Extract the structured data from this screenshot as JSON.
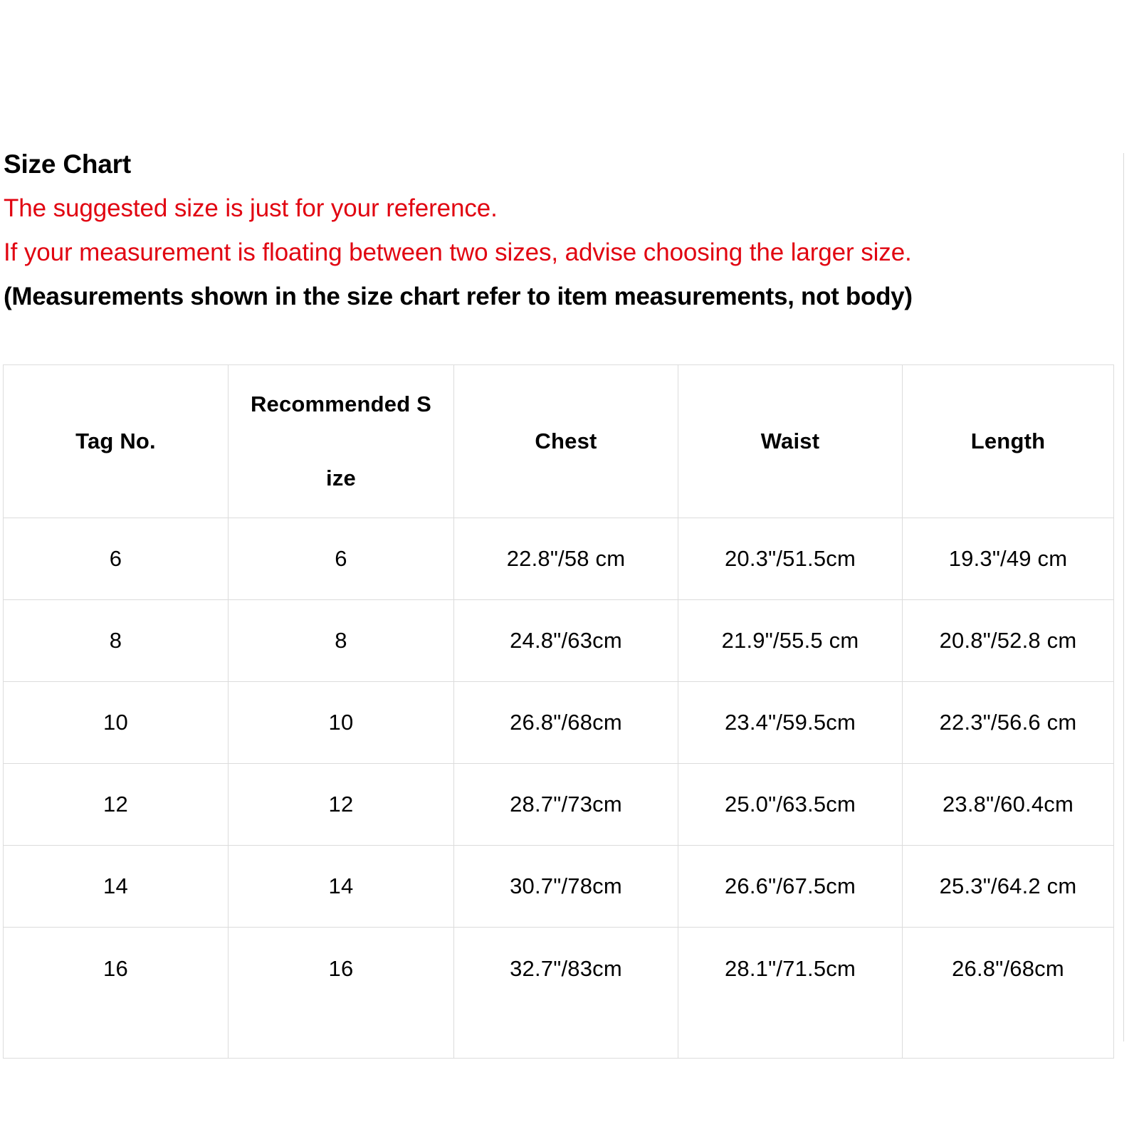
{
  "document": {
    "title": "Size Chart",
    "notes": [
      "The suggested size is just for your reference.",
      "If your measurement is floating between two sizes, advise choosing the larger size."
    ],
    "note_bold": "(Measurements shown in the size chart refer to item measurements, not body)",
    "colors": {
      "note_red": "#e10511",
      "text_black": "#000000",
      "border": "#dcdcdc",
      "background": "#ffffff"
    }
  },
  "chart_data": {
    "type": "table",
    "title": "Size Chart",
    "columns": [
      "Tag No.",
      "Recommended Size",
      "Chest",
      "Waist",
      "Length"
    ],
    "header_display": {
      "col0": "Tag No.",
      "col1_line1": "Recommended S",
      "col1_line2": "ize",
      "col2": "Chest",
      "col3": "Waist",
      "col4": "Length"
    },
    "rows": [
      {
        "tag_no": "6",
        "recommended_size": "6",
        "chest": "22.8\"/58 cm",
        "waist": "20.3\"/51.5cm",
        "length": "19.3\"/49 cm"
      },
      {
        "tag_no": "8",
        "recommended_size": "8",
        "chest": "24.8\"/63cm",
        "waist": "21.9\"/55.5 cm",
        "length": "20.8\"/52.8 cm"
      },
      {
        "tag_no": "10",
        "recommended_size": "10",
        "chest": "26.8\"/68cm",
        "waist": "23.4\"/59.5cm",
        "length": "22.3\"/56.6 cm"
      },
      {
        "tag_no": "12",
        "recommended_size": "12",
        "chest": "28.7\"/73cm",
        "waist": "25.0\"/63.5cm",
        "length": "23.8\"/60.4cm"
      },
      {
        "tag_no": "14",
        "recommended_size": "14",
        "chest": "30.7\"/78cm",
        "waist": "26.6\"/67.5cm",
        "length": "25.3\"/64.2 cm"
      },
      {
        "tag_no": "16",
        "recommended_size": "16",
        "chest": "32.7\"/83cm",
        "waist": "28.1\"/71.5cm",
        "length": "26.8\"/68cm"
      }
    ]
  }
}
